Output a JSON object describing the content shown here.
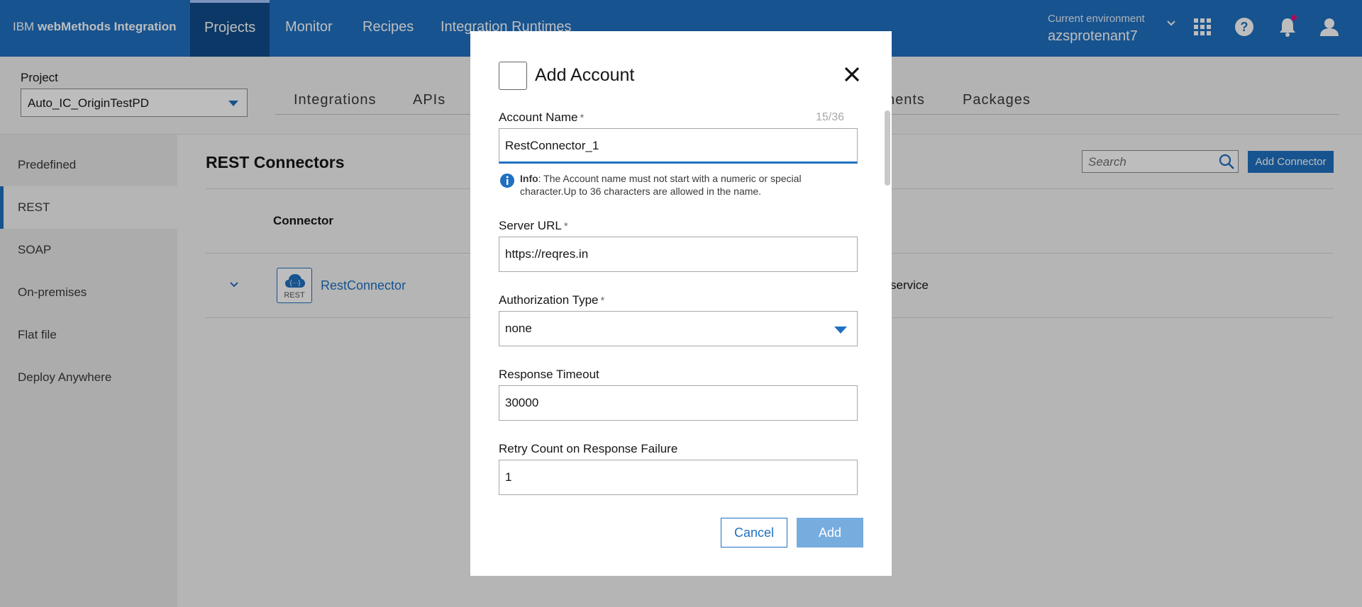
{
  "header": {
    "brand_prefix": "IBM",
    "brand_name": "webMethods Integration",
    "tabs": [
      "Projects",
      "Monitor",
      "Recipes",
      "Integration Runtimes"
    ],
    "env_label": "Current environment",
    "env_value": "azsprotenant7"
  },
  "project": {
    "label": "Project",
    "selected": "Auto_IC_OriginTestPD",
    "subtabs": [
      "Integrations",
      "APIs",
      "nents",
      "Packages"
    ]
  },
  "sidebar": {
    "items": [
      "Predefined",
      "REST",
      "SOAP",
      "On-premises",
      "Flat file",
      "Deploy Anywhere"
    ],
    "active": "REST"
  },
  "main": {
    "title": "REST Connectors",
    "search_placeholder": "Search",
    "add_connector_label": "Add Connector",
    "column_connector": "Connector",
    "row": {
      "logo_text": "REST",
      "name": "RestConnector",
      "desc": "service"
    }
  },
  "modal": {
    "title": "Add Account",
    "account_name_label": "Account Name",
    "required_mark": "*",
    "counter": "15/36",
    "account_name_value": "RestConnector_1",
    "info_bold": "Info",
    "info_text": ": The Account name must not start with a numeric or special character.Up to 36 characters are allowed in the name.",
    "server_url_label": "Server URL",
    "server_url_value": "https://reqres.in",
    "auth_type_label": "Authorization Type",
    "auth_type_value": "none",
    "timeout_label": "Response Timeout",
    "timeout_value": "30000",
    "retry_label": "Retry Count on Response Failure",
    "retry_value": "1",
    "cancel_label": "Cancel",
    "add_label": "Add"
  },
  "colors": {
    "brand_blue": "#1f70c1",
    "active_tab": "#0f4c8a",
    "notification_dot": "#e0147b",
    "add_button_disabled": "#77acdf"
  }
}
